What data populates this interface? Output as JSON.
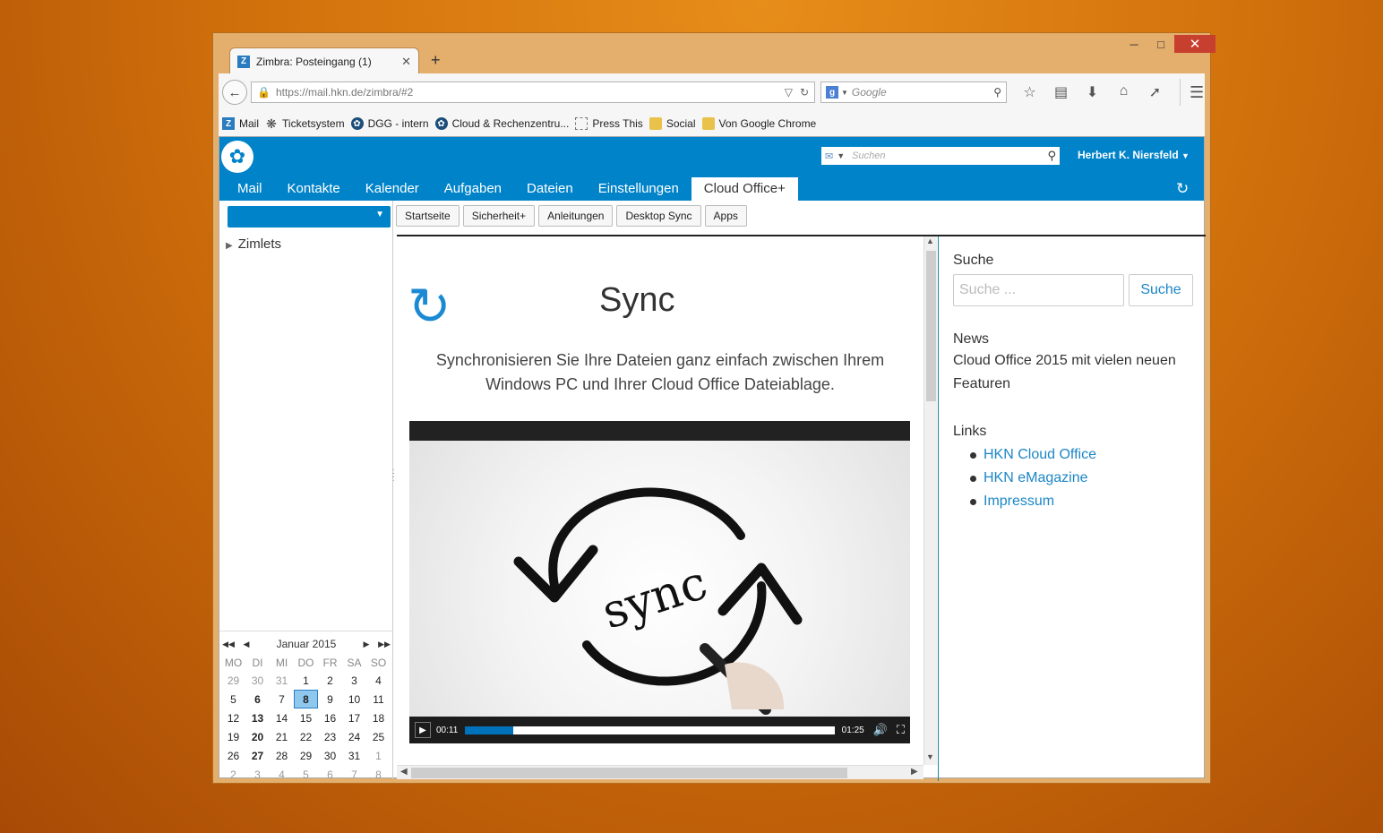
{
  "browser": {
    "tab_title": "Zimbra: Posteingang (1)",
    "url": "https://mail.hkn.de/zimbra/#2",
    "search_placeholder": "Google",
    "bookmarks": [
      "Mail",
      "Ticketsystem",
      "DGG - intern",
      "Cloud & Rechenzentru...",
      "Press This",
      "Social",
      "Von Google Chrome"
    ]
  },
  "zimbra": {
    "search_placeholder": "Suchen",
    "user": "Herbert K. Niersfeld",
    "tabs": [
      "Mail",
      "Kontakte",
      "Kalender",
      "Aufgaben",
      "Dateien",
      "Einstellungen",
      "Cloud Office+"
    ],
    "zimlets": "Zimlets",
    "subnav": [
      "Startseite",
      "Sicherheit+",
      "Anleitungen",
      "Desktop Sync",
      "Apps"
    ]
  },
  "calendar": {
    "month": "Januar 2015",
    "weekdays": [
      "MO",
      "DI",
      "MI",
      "DO",
      "FR",
      "SA",
      "SO"
    ],
    "days": [
      [
        "29",
        "30",
        "31",
        "1",
        "2",
        "3",
        "4"
      ],
      [
        "5",
        "6",
        "7",
        "8",
        "9",
        "10",
        "11"
      ],
      [
        "12",
        "13",
        "14",
        "15",
        "16",
        "17",
        "18"
      ],
      [
        "19",
        "20",
        "21",
        "22",
        "23",
        "24",
        "25"
      ],
      [
        "26",
        "27",
        "28",
        "29",
        "30",
        "31",
        "1"
      ],
      [
        "2",
        "3",
        "4",
        "5",
        "6",
        "7",
        "8"
      ]
    ],
    "today": "8"
  },
  "content": {
    "title": "Sync",
    "description": "Synchronisieren Sie Ihre Dateien ganz einfach zwischen Ihrem Windows PC und Ihrer Cloud Office Dateiablage.",
    "video": {
      "image_text": "sync",
      "elapsed": "00:11",
      "duration": "01:25",
      "progress": 0.13
    }
  },
  "sidebar": {
    "search_heading": "Suche",
    "search_placeholder": "Suche ...",
    "search_button": "Suche",
    "news_heading": "News",
    "news_item": "Cloud Office 2015 mit vielen neuen Featuren",
    "links_heading": "Links",
    "links": [
      "HKN Cloud Office",
      "HKN eMagazine",
      "Impressum"
    ]
  }
}
